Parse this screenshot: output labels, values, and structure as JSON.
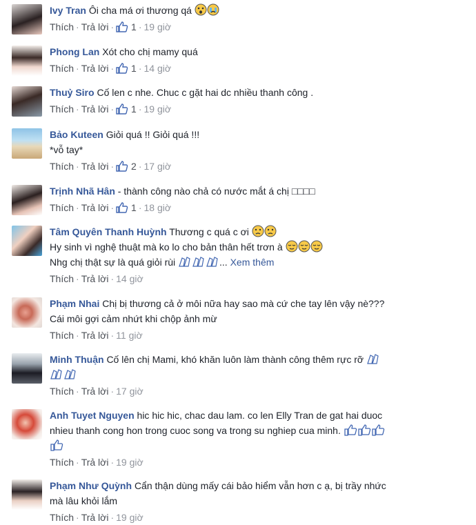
{
  "ui": {
    "like": "Thích",
    "reply": "Trả lời",
    "dot": "·",
    "see_more": "Xem thêm",
    "box_glyphs": "□□□□"
  },
  "comments": [
    {
      "name": "Ivy Tran",
      "lines": [
        "Ôi cha má ơi thương qá"
      ],
      "likes": "1",
      "time": "19 giờ"
    },
    {
      "name": "Phong Lan",
      "lines": [
        "Xót cho chị mamy quá"
      ],
      "likes": "1",
      "time": "14 giờ"
    },
    {
      "name": "Thuỷ Siro",
      "lines": [
        "Cố len c nhe. Chuc c gặt hai dc nhiều thanh công ."
      ],
      "likes": "1",
      "time": "19 giờ"
    },
    {
      "name": "Bảo Kuteen",
      "lines": [
        "Giỏi quá !! Giỏi quá !!!",
        "*vỗ tay*"
      ],
      "likes": "2",
      "time": "17 giờ"
    },
    {
      "name": "Trịnh Nhã Hân",
      "lines": [
        "- thành công nào chả có nước mắt á chị"
      ],
      "likes": "1",
      "time": "18 giờ"
    },
    {
      "name": "Tâm Quyên Thanh Huỳnh",
      "lines": [
        "Thương c quá c ơi",
        "Hy sinh vì nghệ thuật mà ko lo cho bản thân hết trơn à",
        "Nhg chị thật sự là quá giỏi rùi"
      ],
      "likes": "",
      "time": "14 giờ"
    },
    {
      "name": "Phạm Nhai",
      "lines": [
        "Chị bị thương cả ở môi nữa hay sao mà cứ che tay lên vậy nè???",
        "Cái môi gợi cảm nhứt khi chộp ảnh mừ"
      ],
      "likes": "",
      "time": "11 giờ"
    },
    {
      "name": "Minh Thuận",
      "lines": [
        "Cố lên chị Mami, khó khăn luôn làm thành công thêm rực rỡ"
      ],
      "likes": "",
      "time": "17 giờ"
    },
    {
      "name": "Anh Tuyet Nguyen",
      "lines": [
        "hic hic hic, chac dau lam. co len Elly Tran de gat hai duoc",
        "nhieu thanh cong hon trong cuoc song va trong su nghiep cua minh."
      ],
      "likes": "",
      "time": "19 giờ"
    },
    {
      "name": "Phạm Như Quỳnh",
      "lines": [
        "Cẩn thận dùng mấy cái bảo hiểm vẫn hơn c ạ, bị trầy nhức",
        "mà lâu khỏi lắm"
      ],
      "likes": "",
      "time": "19 giờ"
    }
  ],
  "colors": {
    "name": "#365899",
    "text": "#1d2129",
    "meta": "#90949c",
    "like_blue": "#4267b2",
    "emoji_yellow": "#f7c948"
  }
}
